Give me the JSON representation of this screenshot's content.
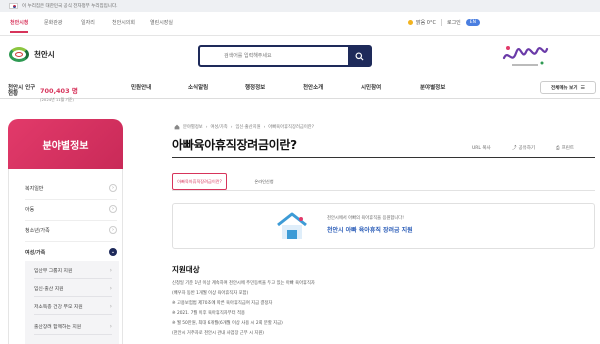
{
  "gov_banner": {
    "text": "이 누리집은 대한민국 공식 전자정부 누리집입니다.",
    "link": ""
  },
  "topbar": {
    "site_tabs": [
      "천안시청",
      "문화관광",
      "일자리",
      "천안시의회",
      "열린시장실"
    ],
    "weather": "맑음 0°C",
    "login": "로그인",
    "lang": "EN"
  },
  "header": {
    "logo_text": "천안시",
    "search_placeholder": "검색어를 입력해주세요",
    "brand": "천안시"
  },
  "population": {
    "label": "천안시 인구현황",
    "value": "700,403 명",
    "date": "(2024년 11월 기준)"
  },
  "nav": {
    "items": [
      "민원안내",
      "소식알림",
      "행정정보",
      "천안소개",
      "시민참여",
      "분야별정보"
    ],
    "sitemap": "전체메뉴 보기"
  },
  "sidebar": {
    "title": "분야별정보",
    "items": [
      {
        "label": "복지일반",
        "active": false
      },
      {
        "label": "아동",
        "active": false
      },
      {
        "label": "청소년/가족",
        "active": false
      },
      {
        "label": "여성/가족",
        "active": true
      }
    ],
    "sub_items": [
      "임산부 그룹지 지원",
      "임신·출산 지원",
      "저소득층 건강 부모 지원",
      "출산장려 함께하는 지원"
    ]
  },
  "main": {
    "breadcrumb": [
      "분야별정보",
      "여성/가족",
      "임신·출산지원",
      "아빠육아휴직장려금이란?"
    ],
    "title": "아빠육아휴직장려금이란?",
    "tools": {
      "url": "URL 복사",
      "share": "공유하기",
      "print": "프린트"
    },
    "tabs": [
      "아빠육아휴직장려금이란?",
      "온라인신청"
    ],
    "info_sub": "천안시에서 아빠의 육아휴직을 응원합니다!",
    "info_main": "천안시 아빠 육아휴직 장려금 지원",
    "section_title": "지원대상",
    "body_lines": [
      "신청일 기준 1년 이상 계속하여 천안시에 주민등록을 두고 있는 아빠 육아휴직자",
      "(배우자 동반 1개월 이상 육아휴직자 포함)",
      "※ 고용보험법 제70조에 따른 육아휴직급여 지급 결정자",
      "※ 2021. 7월 이후 육아휴직자부터 적용",
      "※ 월 50만원, 최대 6개월(6개월 이상 사용 시 2회 분할 지급)",
      "(천안시 거주자로 천안시 관내 사업장 근무 시 지원)"
    ]
  }
}
